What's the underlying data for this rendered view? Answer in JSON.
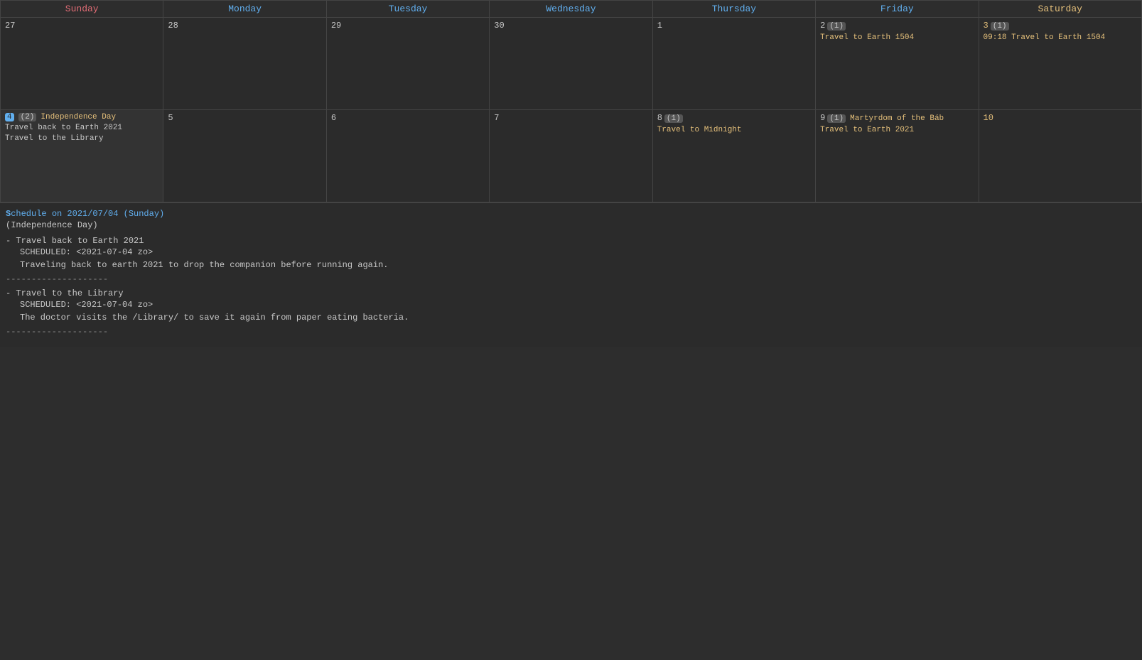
{
  "calendar": {
    "weekdays": [
      {
        "label": "Sunday",
        "class": "th-sun"
      },
      {
        "label": "Monday",
        "class": "th-mon"
      },
      {
        "label": "Tuesday",
        "class": "th-tue"
      },
      {
        "label": "Wednesday",
        "class": "th-wed"
      },
      {
        "label": "Thursday",
        "class": "th-thu"
      },
      {
        "label": "Friday",
        "class": "th-fri"
      },
      {
        "label": "Saturday",
        "class": "th-sat"
      }
    ],
    "rows": [
      {
        "cells": [
          {
            "day": "27",
            "type": "prev",
            "events": []
          },
          {
            "day": "28",
            "type": "prev",
            "events": []
          },
          {
            "day": "29",
            "type": "prev",
            "events": []
          },
          {
            "day": "30",
            "type": "prev",
            "events": []
          },
          {
            "day": "1",
            "type": "current",
            "events": []
          },
          {
            "day": "2",
            "type": "current",
            "badge": "(1)",
            "events": [
              {
                "text": "Travel to Earth 1504",
                "color": "orange"
              }
            ]
          },
          {
            "day": "3",
            "type": "current",
            "badge": "(1)",
            "daynumClass": "sat",
            "events": [
              {
                "text": "09:18 Travel to Earth 1504",
                "color": "orange"
              }
            ]
          }
        ]
      },
      {
        "cells": [
          {
            "day": "4",
            "type": "selected",
            "badge": "(2)",
            "holiday": "Independence Day",
            "events": [
              {
                "text": "Travel back to Earth 2021",
                "color": "normal"
              },
              {
                "text": "Travel to the Library",
                "color": "normal"
              }
            ]
          },
          {
            "day": "5",
            "type": "current",
            "events": []
          },
          {
            "day": "6",
            "type": "current",
            "events": []
          },
          {
            "day": "7",
            "type": "current",
            "events": []
          },
          {
            "day": "8",
            "type": "current",
            "badge": "(1)",
            "events": [
              {
                "text": "Travel to Midnight",
                "color": "orange"
              }
            ]
          },
          {
            "day": "9",
            "type": "current",
            "badge": "(1)",
            "holiday": "Martyrdom of the Báb",
            "events": [
              {
                "text": "Travel to Earth 2021",
                "color": "orange"
              }
            ]
          },
          {
            "day": "10",
            "type": "current",
            "daynumClass": "highlight",
            "events": []
          }
        ]
      }
    ]
  },
  "schedule": {
    "date_label": "Schedule on 2021/07/04 (Sunday)",
    "holiday_label": "(Independence Day)",
    "entries": [
      {
        "title": "- Travel back to Earth 2021",
        "scheduled": "SCHEDULED: <2021-07-04 zo>",
        "description": "Traveling back to earth 2021 to drop the companion before running again."
      },
      {
        "title": "- Travel to the Library",
        "scheduled": "SCHEDULED: <2021-07-04 zo>",
        "description": "The doctor visits the /Library/ to save it again from paper eating bacteria."
      }
    ],
    "divider": "--------------------"
  }
}
